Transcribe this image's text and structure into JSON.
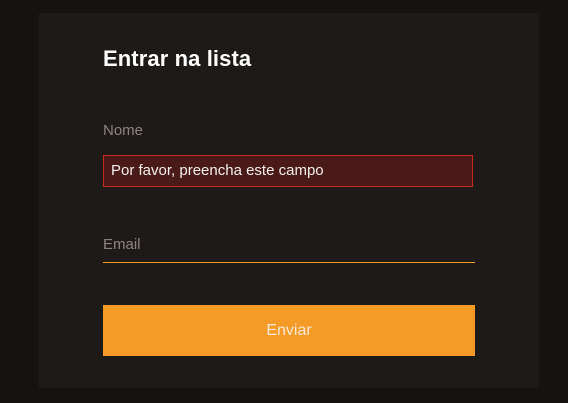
{
  "form": {
    "title": "Entrar na lista",
    "name_label": "Nome",
    "name_error": "Por favor, preencha este campo",
    "email_placeholder": "Email",
    "submit_label": "Enviar"
  },
  "colors": {
    "page_background": "#151210",
    "card_background": "#1e1a18",
    "accent": "#f39b26",
    "error_border": "#c92a20",
    "error_background": "#4a1a18",
    "label_text": "#8b8580",
    "title_text": "#ffffff"
  }
}
